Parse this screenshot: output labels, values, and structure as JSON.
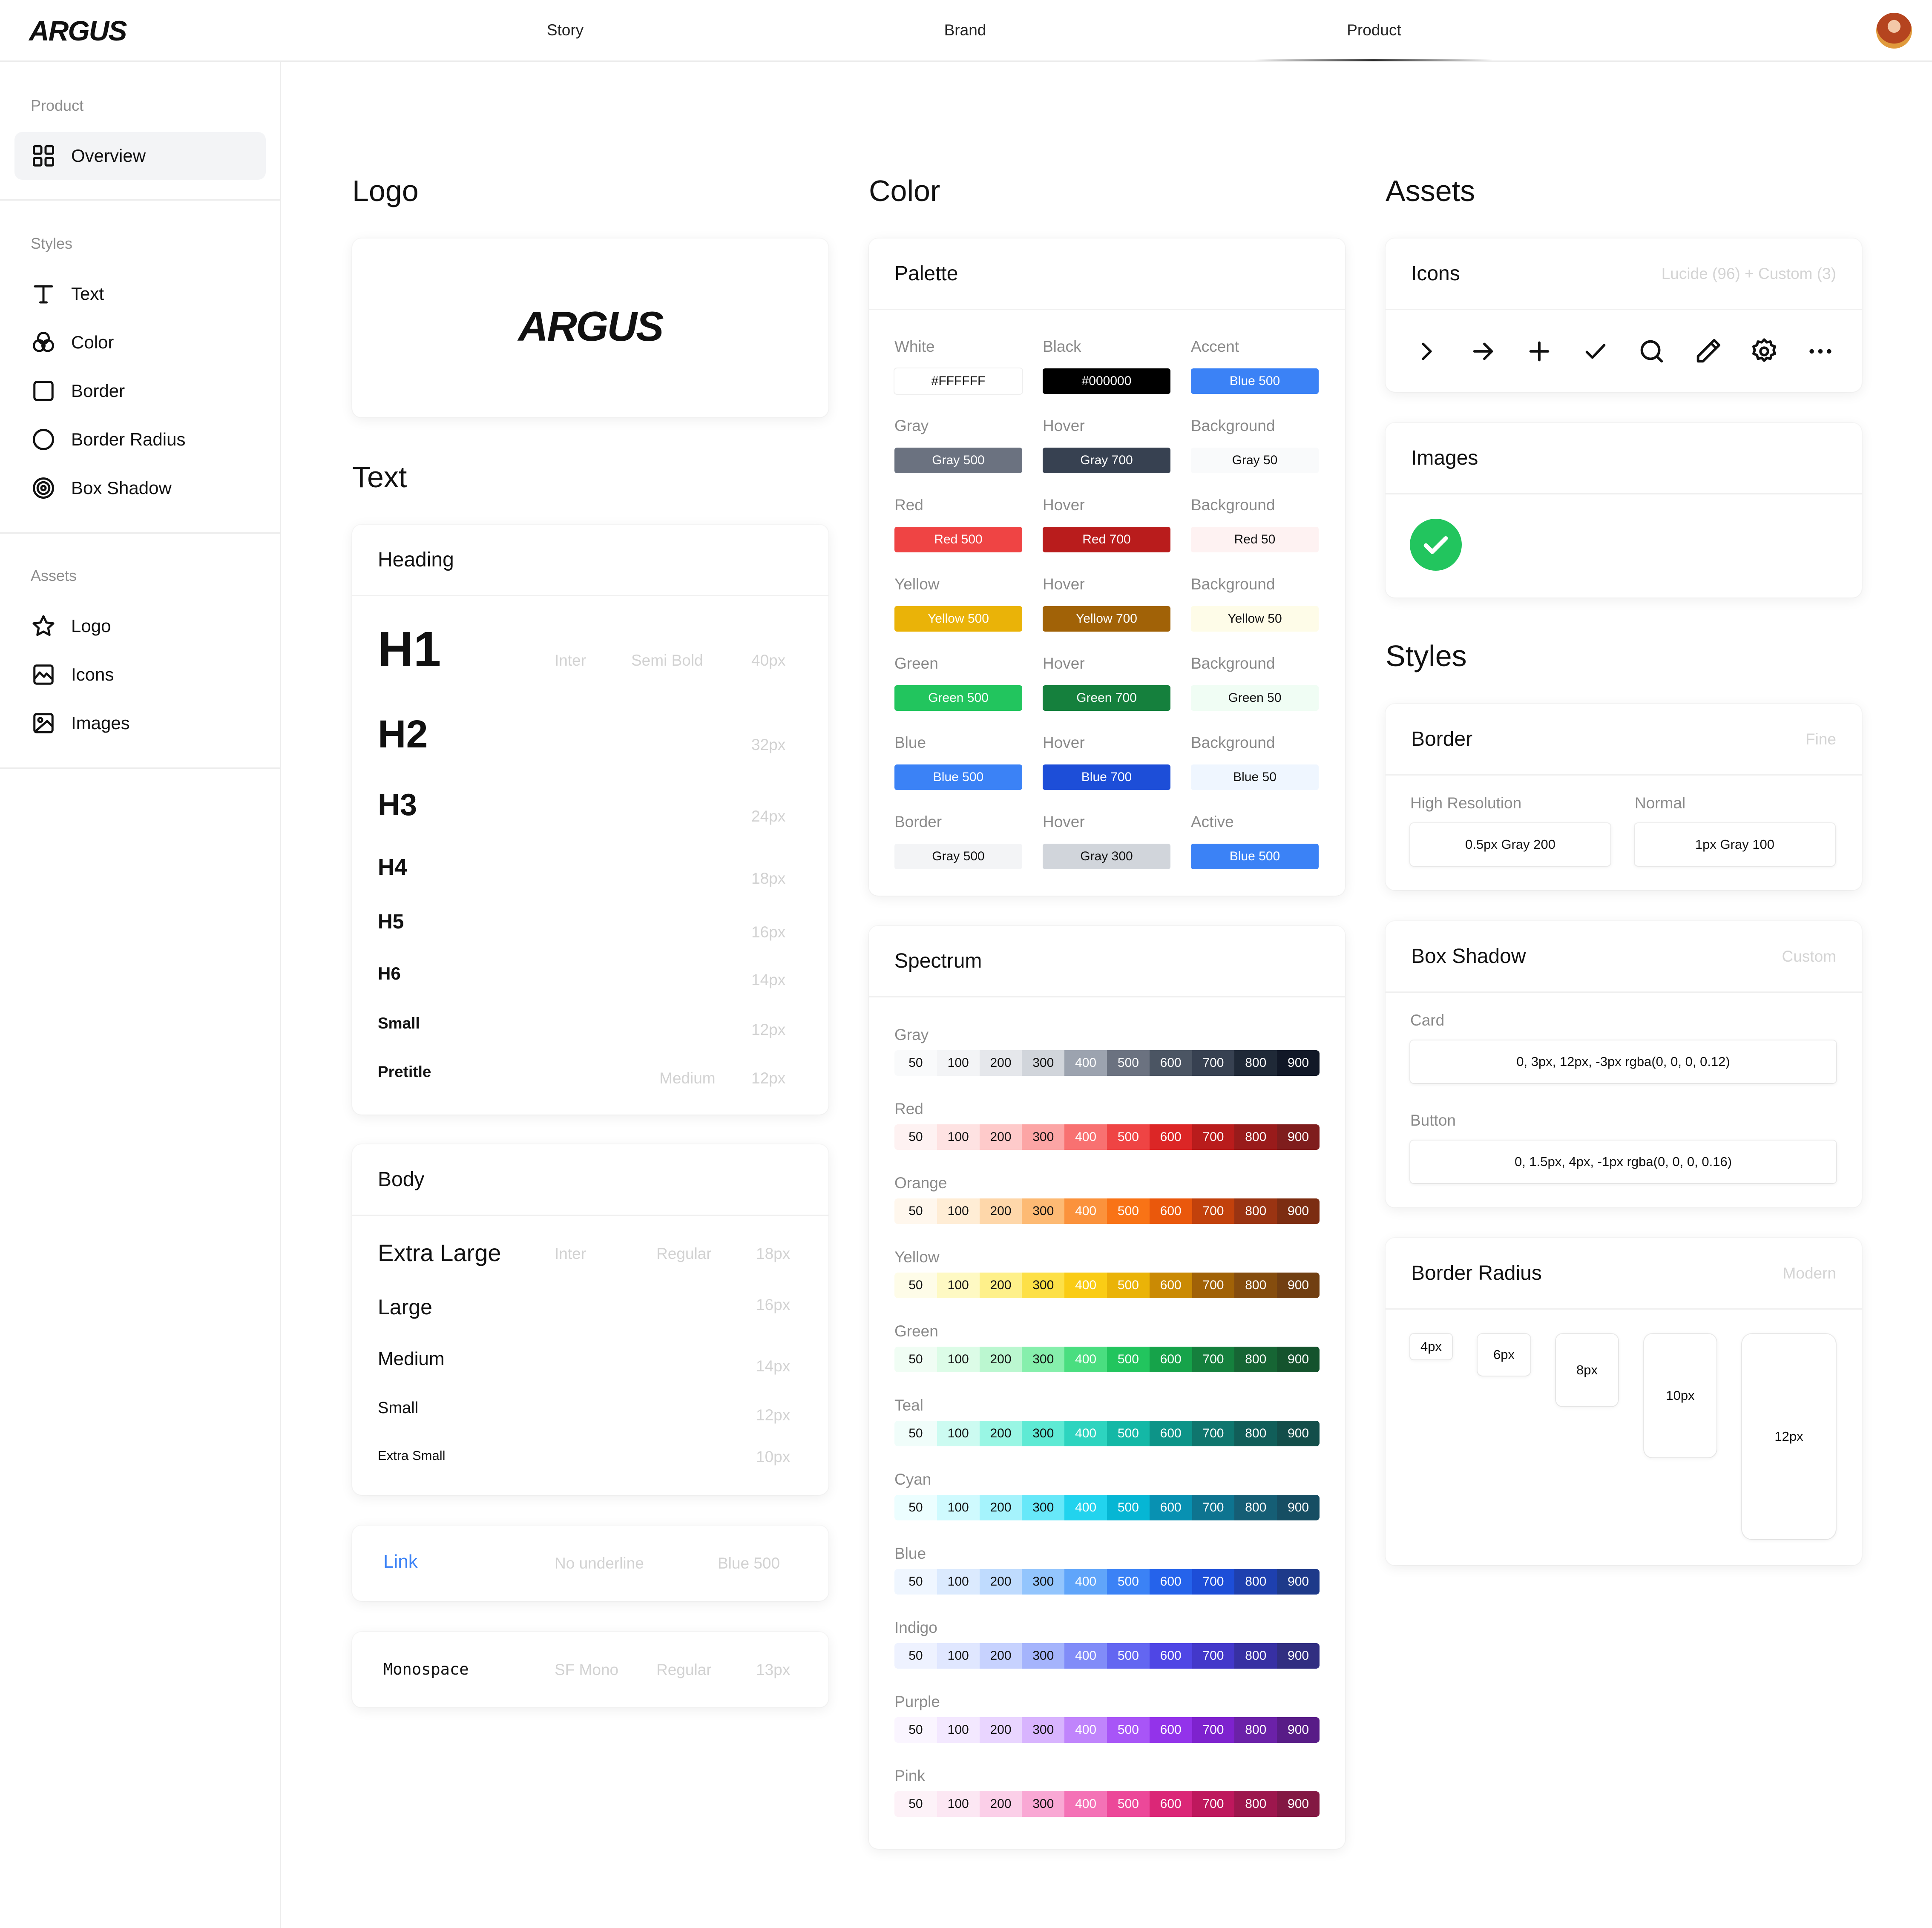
{
  "topbar": {
    "brand": "ARGUS",
    "nav": [
      "Story",
      "Brand",
      "Product"
    ],
    "active_nav": "Product"
  },
  "sidebar": {
    "sections": [
      {
        "heading": "Product",
        "items": [
          {
            "label": "Overview",
            "icon": "grid-icon",
            "active": true
          }
        ]
      },
      {
        "heading": "Styles",
        "items": [
          {
            "label": "Text",
            "icon": "type-icon"
          },
          {
            "label": "Color",
            "icon": "color-circles-icon"
          },
          {
            "label": "Border",
            "icon": "square-icon"
          },
          {
            "label": "Border Radius",
            "icon": "circle-icon"
          },
          {
            "label": "Box Shadow",
            "icon": "target-icon"
          }
        ]
      },
      {
        "heading": "Assets",
        "items": [
          {
            "label": "Logo",
            "icon": "star-icon"
          },
          {
            "label": "Icons",
            "icon": "image-frame-icon"
          },
          {
            "label": "Images",
            "icon": "image-icon"
          }
        ]
      }
    ]
  },
  "logo_section": {
    "title": "Logo",
    "wordmark": "ARGUS"
  },
  "text_section": {
    "title": "Text",
    "heading_card": {
      "title": "Heading",
      "rows": [
        {
          "label": "H1",
          "font": "Inter",
          "weight": "Semi Bold",
          "size": "40px"
        },
        {
          "label": "H2",
          "size": "32px"
        },
        {
          "label": "H3",
          "size": "24px"
        },
        {
          "label": "H4",
          "size": "18px"
        },
        {
          "label": "H5",
          "size": "16px"
        },
        {
          "label": "H6",
          "size": "14px"
        },
        {
          "label": "Small",
          "size": "12px"
        },
        {
          "label": "Pretitle",
          "weight": "Medium",
          "size": "12px"
        }
      ]
    },
    "body_card": {
      "title": "Body",
      "rows": [
        {
          "label": "Extra Large",
          "font": "Inter",
          "weight": "Regular",
          "size": "18px"
        },
        {
          "label": "Large",
          "size": "16px"
        },
        {
          "label": "Medium",
          "size": "14px"
        },
        {
          "label": "Small",
          "size": "12px"
        },
        {
          "label": "Extra Small",
          "size": "10px"
        }
      ]
    },
    "link_card": {
      "label": "Link",
      "style": "No underline",
      "color": "Blue 500"
    },
    "mono_card": {
      "label": "Monospace",
      "font": "SF Mono",
      "weight": "Regular",
      "size": "13px"
    }
  },
  "color_section": {
    "title": "Color",
    "palette": {
      "title": "Palette",
      "rows": [
        [
          {
            "label": "White",
            "value": "#FFFFFF",
            "bg": "#ffffff",
            "fg": "#111111",
            "outline": true
          },
          {
            "label": "Black",
            "value": "#000000",
            "bg": "#000000",
            "fg": "#ffffff"
          },
          {
            "label": "Accent",
            "value": "Blue 500",
            "bg": "#3b82f6",
            "fg": "#ffffff"
          }
        ],
        [
          {
            "label": "Gray",
            "value": "Gray 500",
            "bg": "#6b7280",
            "fg": "#ffffff"
          },
          {
            "label": "Hover",
            "value": "Gray 700",
            "bg": "#374151",
            "fg": "#ffffff"
          },
          {
            "label": "Background",
            "value": "Gray 50",
            "bg": "#f9fafb",
            "fg": "#111111"
          }
        ],
        [
          {
            "label": "Red",
            "value": "Red 500",
            "bg": "#ef4444",
            "fg": "#ffffff"
          },
          {
            "label": "Hover",
            "value": "Red 700",
            "bg": "#b91c1c",
            "fg": "#ffffff"
          },
          {
            "label": "Background",
            "value": "Red 50",
            "bg": "#fef2f2",
            "fg": "#111111"
          }
        ],
        [
          {
            "label": "Yellow",
            "value": "Yellow 500",
            "bg": "#eab308",
            "fg": "#ffffff"
          },
          {
            "label": "Hover",
            "value": "Yellow 700",
            "bg": "#a16207",
            "fg": "#ffffff"
          },
          {
            "label": "Background",
            "value": "Yellow 50",
            "bg": "#fefce8",
            "fg": "#111111"
          }
        ],
        [
          {
            "label": "Green",
            "value": "Green 500",
            "bg": "#22c55e",
            "fg": "#ffffff"
          },
          {
            "label": "Hover",
            "value": "Green 700",
            "bg": "#15803d",
            "fg": "#ffffff"
          },
          {
            "label": "Background",
            "value": "Green 50",
            "bg": "#f0fdf4",
            "fg": "#111111"
          }
        ],
        [
          {
            "label": "Blue",
            "value": "Blue 500",
            "bg": "#3b82f6",
            "fg": "#ffffff"
          },
          {
            "label": "Hover",
            "value": "Blue 700",
            "bg": "#1d4ed8",
            "fg": "#ffffff"
          },
          {
            "label": "Background",
            "value": "Blue 50",
            "bg": "#eff6ff",
            "fg": "#111111"
          }
        ],
        [
          {
            "label": "Border",
            "value": "Gray 500",
            "bg": "#f3f4f6",
            "fg": "#111111"
          },
          {
            "label": "Hover",
            "value": "Gray 300",
            "bg": "#d1d5db",
            "fg": "#111111"
          },
          {
            "label": "Active",
            "value": "Blue 500",
            "bg": "#3b82f6",
            "fg": "#ffffff"
          }
        ]
      ]
    },
    "spectrum": {
      "title": "Spectrum",
      "steps": [
        "50",
        "100",
        "200",
        "300",
        "400",
        "500",
        "600",
        "700",
        "800",
        "900"
      ],
      "scales": [
        {
          "name": "Gray",
          "colors": [
            "#f9fafb",
            "#f3f4f6",
            "#e5e7eb",
            "#d1d5db",
            "#9ca3af",
            "#6b7280",
            "#4b5563",
            "#374151",
            "#1f2937",
            "#111827"
          ]
        },
        {
          "name": "Red",
          "colors": [
            "#fef2f2",
            "#fee2e2",
            "#fecaca",
            "#fca5a5",
            "#f87171",
            "#ef4444",
            "#dc2626",
            "#b91c1c",
            "#991b1b",
            "#7f1d1d"
          ]
        },
        {
          "name": "Orange",
          "colors": [
            "#fff7ed",
            "#ffedd5",
            "#fed7aa",
            "#fdba74",
            "#fb923c",
            "#f97316",
            "#ea580c",
            "#c2410c",
            "#9a3412",
            "#7c2d12"
          ]
        },
        {
          "name": "Yellow",
          "colors": [
            "#fefce8",
            "#fef9c3",
            "#fef08a",
            "#fde047",
            "#facc15",
            "#eab308",
            "#ca8a04",
            "#a16207",
            "#854d0e",
            "#713f12"
          ]
        },
        {
          "name": "Green",
          "colors": [
            "#f0fdf4",
            "#dcfce7",
            "#bbf7d0",
            "#86efac",
            "#4ade80",
            "#22c55e",
            "#16a34a",
            "#15803d",
            "#166534",
            "#14532d"
          ]
        },
        {
          "name": "Teal",
          "colors": [
            "#f0fdfa",
            "#ccfbf1",
            "#99f6e4",
            "#5eead4",
            "#2dd4bf",
            "#14b8a6",
            "#0d9488",
            "#0f766e",
            "#115e59",
            "#134e4a"
          ]
        },
        {
          "name": "Cyan",
          "colors": [
            "#ecfeff",
            "#cffafe",
            "#a5f3fc",
            "#67e8f9",
            "#22d3ee",
            "#06b6d4",
            "#0891b2",
            "#0e7490",
            "#155e75",
            "#164e63"
          ]
        },
        {
          "name": "Blue",
          "colors": [
            "#eff6ff",
            "#dbeafe",
            "#bfdbfe",
            "#93c5fd",
            "#60a5fa",
            "#3b82f6",
            "#2563eb",
            "#1d4ed8",
            "#1e40af",
            "#1e3a8a"
          ]
        },
        {
          "name": "Indigo",
          "colors": [
            "#eef2ff",
            "#e0e7ff",
            "#c7d2fe",
            "#a5b4fc",
            "#818cf8",
            "#6366f1",
            "#4f46e5",
            "#4338ca",
            "#3730a3",
            "#312e81"
          ]
        },
        {
          "name": "Purple",
          "colors": [
            "#faf5ff",
            "#f3e8ff",
            "#e9d5ff",
            "#d8b4fe",
            "#c084fc",
            "#a855f7",
            "#9333ea",
            "#7e22ce",
            "#6b21a8",
            "#581c87"
          ]
        },
        {
          "name": "Pink",
          "colors": [
            "#fdf2f8",
            "#fce7f3",
            "#fbcfe8",
            "#f9a8d4",
            "#f472b6",
            "#ec4899",
            "#db2777",
            "#be185d",
            "#9d174d",
            "#831843"
          ]
        }
      ]
    }
  },
  "assets_section": {
    "title": "Assets",
    "icons_card": {
      "title": "Icons",
      "note": "Lucide (96) + Custom (3)",
      "icons": [
        "chevron-right-icon",
        "arrow-right-icon",
        "plus-icon",
        "check-icon",
        "search-icon",
        "pencil-icon",
        "settings-icon",
        "more-horizontal-icon"
      ]
    },
    "images_card": {
      "title": "Images",
      "image": "green-check-badge-icon"
    }
  },
  "styles_section": {
    "title": "Styles",
    "border_card": {
      "title": "Border",
      "note": "Fine",
      "items": [
        {
          "label": "High Resolution",
          "value": "0.5px Gray 200"
        },
        {
          "label": "Normal",
          "value": "1px Gray 100"
        }
      ]
    },
    "shadow_card": {
      "title": "Box Shadow",
      "note": "Custom",
      "items": [
        {
          "label": "Card",
          "value": "0, 3px, 12px, -3px rgba(0, 0, 0, 0.12)"
        },
        {
          "label": "Button",
          "value": "0, 1.5px, 4px, -1px rgba(0, 0, 0, 0.16)"
        }
      ]
    },
    "radius_card": {
      "title": "Border Radius",
      "note": "Modern",
      "items": [
        "4px",
        "6px",
        "8px",
        "10px",
        "12px"
      ]
    }
  }
}
